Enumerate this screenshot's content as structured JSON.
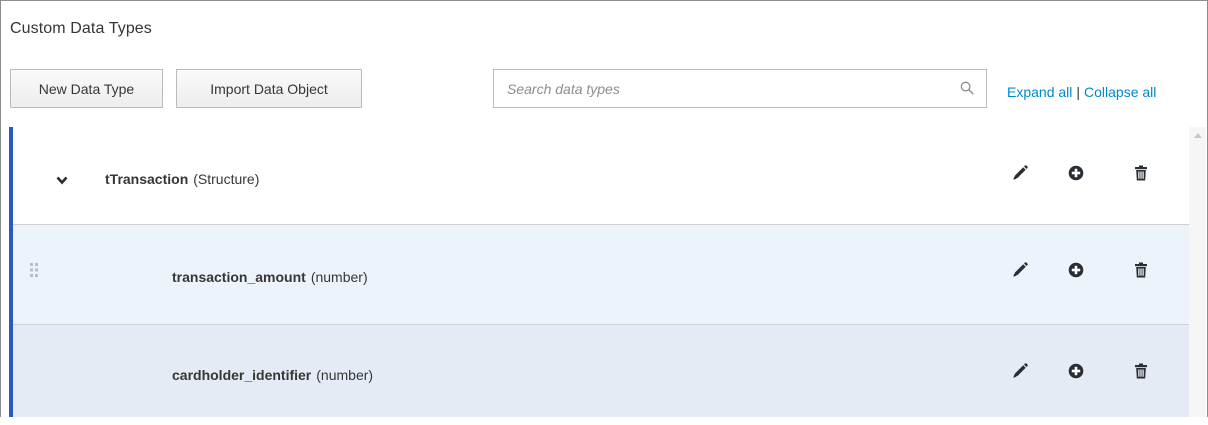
{
  "panel": {
    "title": "Custom Data Types"
  },
  "toolbar": {
    "new_label": "New Data Type",
    "import_label": "Import Data Object",
    "search_placeholder": "Search data types",
    "search_value": "",
    "expand_all": "Expand all",
    "separator": "|",
    "collapse_all": "Collapse all"
  },
  "rows": [
    {
      "name": "tTransaction",
      "type": "(Structure)",
      "expanded": true,
      "icons": [
        "chevron-down-icon",
        "pencil-icon",
        "plus-circle-icon",
        "trash-icon"
      ]
    },
    {
      "name": "transaction_amount",
      "type": "(number)",
      "icons": [
        "drag-handle-icon",
        "pencil-icon",
        "plus-circle-icon",
        "trash-icon"
      ]
    },
    {
      "name": "cardholder_identifier",
      "type": "(number)",
      "icons": [
        "pencil-icon",
        "plus-circle-icon",
        "trash-icon"
      ]
    }
  ],
  "colors": {
    "accent_bar": "#2d57c1",
    "link": "#0088ce",
    "row_hover": "#edf3fb",
    "row_selected": "#e4ebf5"
  }
}
